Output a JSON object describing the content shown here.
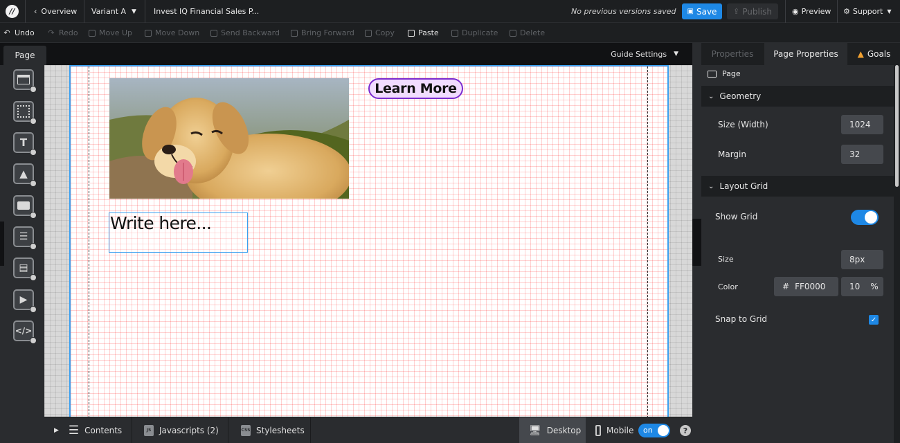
{
  "topbar": {
    "overview_label": "Overview",
    "variant_label": "Variant A",
    "page_title": "Invest IQ Financial Sales P...",
    "versions_status": "No previous versions saved",
    "save_label": "Save",
    "publish_label": "Publish",
    "preview_label": "Preview",
    "support_label": "Support"
  },
  "toolbar": {
    "undo": "Undo",
    "redo": "Redo",
    "move_up": "Move Up",
    "move_down": "Move Down",
    "send_backward": "Send Backward",
    "bring_forward": "Bring Forward",
    "copy": "Copy",
    "paste": "Paste",
    "duplicate": "Duplicate",
    "delete": "Delete"
  },
  "page_strip": {
    "tab_label": "Page",
    "guide_settings": "Guide Settings"
  },
  "rail": {
    "tools": [
      "section-tool",
      "box-tool",
      "text-tool",
      "image-tool",
      "button-tool",
      "form-tool",
      "lightbox-tool",
      "video-tool",
      "custom-html-tool"
    ]
  },
  "canvas": {
    "learn_more_label": "Learn More",
    "text_placeholder": "Write here...",
    "image_alt": "Golden retriever puppy outdoors"
  },
  "bottombar": {
    "contents": "Contents",
    "javascripts": "Javascripts (2)",
    "stylesheets": "Stylesheets",
    "desktop": "Desktop",
    "mobile": "Mobile",
    "mobile_toggle": "on",
    "help": "?"
  },
  "right_panel": {
    "tabs": [
      "Properties",
      "Page Properties",
      "Goals"
    ],
    "page_label": "Page",
    "geometry": {
      "title": "Geometry",
      "size_label": "Size (Width)",
      "size_value": "1024",
      "margin_label": "Margin",
      "margin_value": "32"
    },
    "layout_grid": {
      "title": "Layout Grid",
      "show_grid_label": "Show Grid",
      "show_grid": true,
      "size_label": "Size",
      "size_value": "8px",
      "color_label": "Color",
      "color_hash": "#",
      "color_value": "FF0000",
      "opacity_value": "10",
      "opacity_unit": "%",
      "snap_label": "Snap to Grid",
      "snap": true
    }
  },
  "colors": {
    "accent": "#1e88e5",
    "button_border": "#7b2ccf",
    "button_fill": "#f1dcff",
    "grid_color": "#FF0000"
  }
}
